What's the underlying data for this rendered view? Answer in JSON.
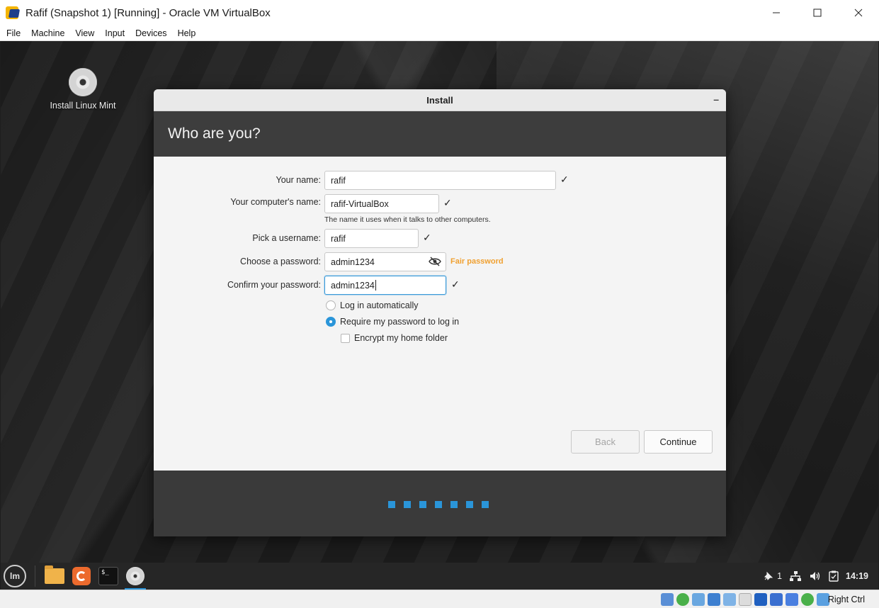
{
  "window": {
    "title": "Rafif (Snapshot 1) [Running] - Oracle VM VirtualBox",
    "menu": [
      "File",
      "Machine",
      "View",
      "Input",
      "Devices",
      "Help"
    ]
  },
  "desktop": {
    "icon_label": "Install Linux Mint"
  },
  "dialog": {
    "title": "Install",
    "heading": "Who are you?",
    "fields": {
      "name_label": "Your name:",
      "name_value": "rafif",
      "computer_label": "Your computer's name:",
      "computer_value": "rafif-VirtualBox",
      "computer_hint": "The name it uses when it talks to other computers.",
      "username_label": "Pick a username:",
      "username_value": "rafif",
      "password_label": "Choose a password:",
      "password_value": "admin1234",
      "password_strength": "Fair password",
      "confirm_label": "Confirm your password:",
      "confirm_value": "admin1234"
    },
    "options": {
      "auto_login": "Log in automatically",
      "require_password": "Require my password to log in",
      "encrypt_home": "Encrypt my home folder",
      "selected": "require_password",
      "encrypt_checked": false
    },
    "buttons": {
      "back": "Back",
      "continue": "Continue"
    },
    "progress_dots": 7
  },
  "panel": {
    "workspace": "1",
    "clock": "14:19",
    "menu_symbol": "lm"
  },
  "statusbar": {
    "host_key": "Right Ctrl"
  },
  "colors": {
    "accent": "#2a95d9",
    "strength": "#f0a030"
  }
}
